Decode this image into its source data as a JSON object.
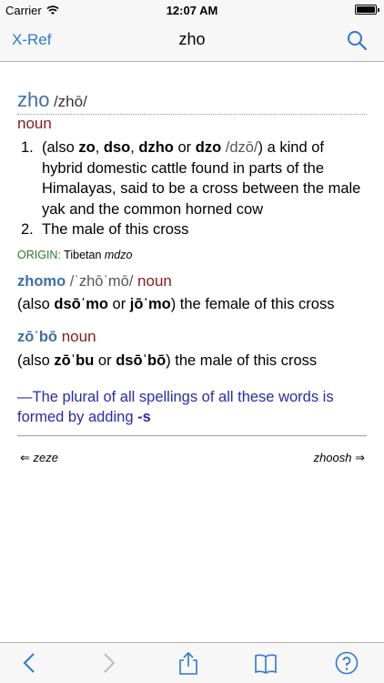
{
  "status": {
    "carrier": "Carrier",
    "time": "12:07 AM"
  },
  "nav": {
    "xref_label": "X-Ref",
    "title": "zho"
  },
  "entry": {
    "headword": "zho",
    "pronunciation": "/zhō/",
    "pos": "noun",
    "sense1": {
      "num": "1.",
      "pre": "(also ",
      "v1": "zo",
      "s1": ", ",
      "v2": "dso",
      "s2": ", ",
      "v3": "dzho",
      "s3": " or ",
      "v4": "dzo",
      "pron4": " /dzō/",
      "rest": ") a kind of hybrid domestic cattle found in parts of the Himalayas, said to be a cross between the male yak and the common horned cow"
    },
    "sense2": {
      "num": "2.",
      "text": "The male of this cross"
    },
    "origin": {
      "label": "ORIGIN:",
      "lang": "Tibetan",
      "word": "mdzo"
    },
    "sub1": {
      "word": "zhomo",
      "pron": " /ˈzhōˈmō/ ",
      "pos": "noun",
      "pre": "(also ",
      "v1": "dsōˈmo",
      "mid": " or ",
      "v2": "jōˈmo",
      "rest": ") the female of this cross"
    },
    "sub2": {
      "word": "zōˈbō",
      "pos": " noun",
      "pre": "(also ",
      "v1": "zōˈbu",
      "mid": " or ",
      "v2": "dsōˈbō",
      "rest": ") the male of this cross"
    },
    "note": {
      "text": "—The plural of all spellings of all these words is formed by adding ",
      "suffix": "-s"
    }
  },
  "footer_nav": {
    "prev": "⇐ zeze",
    "next": "zhoosh ⇒"
  },
  "toolbar": {
    "icons": [
      "back-icon",
      "forward-icon",
      "share-icon",
      "bookmarks-icon",
      "help-icon"
    ]
  },
  "colors": {
    "accent": "#2c79d3",
    "headword": "#3e6ea8",
    "pos": "#8b1a1a",
    "origin": "#2a7a2a",
    "note": "#2a2ab0"
  }
}
